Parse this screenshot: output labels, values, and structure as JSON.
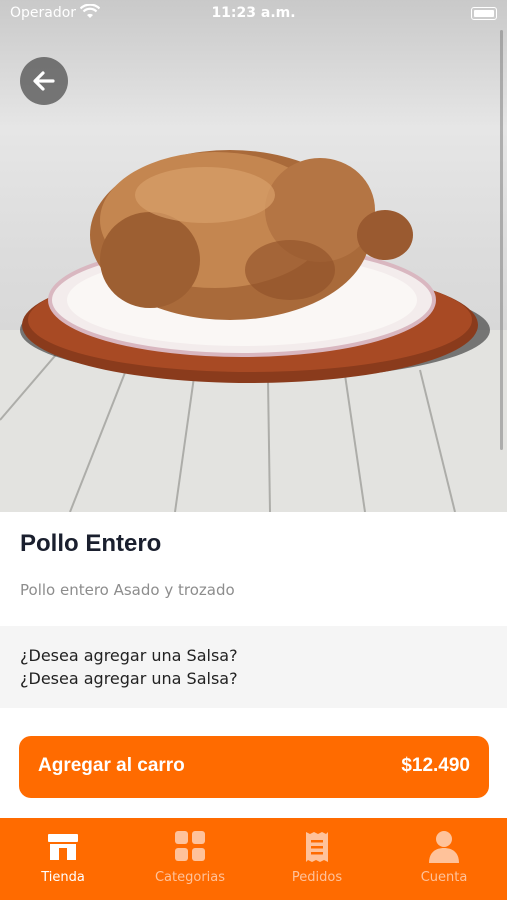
{
  "status_bar": {
    "carrier": "Operador",
    "time": "11:23 a.m."
  },
  "product": {
    "name": "Pollo Entero",
    "description": "Pollo entero Asado y trozado",
    "image_alt": "roast-chicken-image"
  },
  "sauce_prompt": {
    "line1": "¿Desea agregar una Salsa?",
    "line2": "¿Desea agregar una Salsa?"
  },
  "cart_button": {
    "label": "Agregar al carro",
    "price": "$12.490"
  },
  "tabs": [
    {
      "label": "Tienda",
      "icon": "store-icon",
      "active": true
    },
    {
      "label": "Categorias",
      "icon": "grid-icon",
      "active": false
    },
    {
      "label": "Pedidos",
      "icon": "receipt-icon",
      "active": false
    },
    {
      "label": "Cuenta",
      "icon": "user-icon",
      "active": false
    }
  ],
  "colors": {
    "accent": "#ff6b00",
    "inactive_tab": "#ffc29a"
  }
}
